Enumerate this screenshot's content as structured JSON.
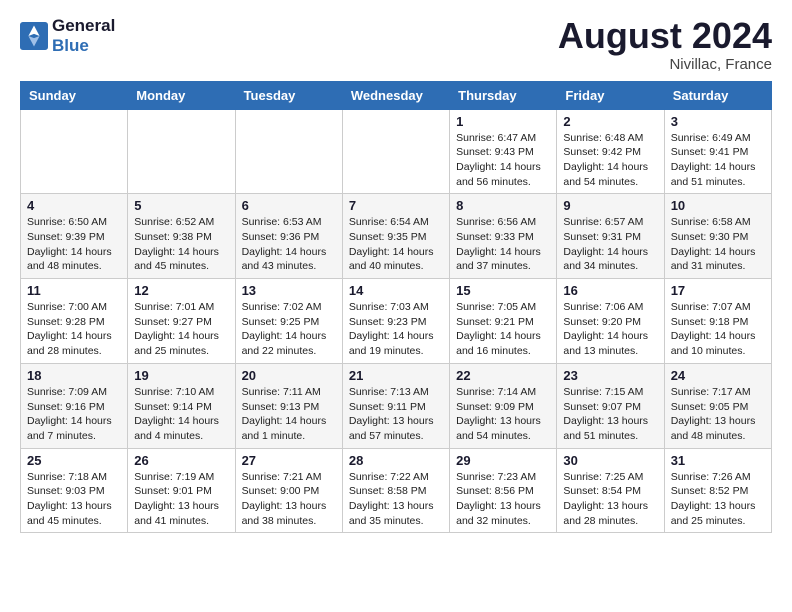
{
  "header": {
    "logo_line1": "General",
    "logo_line2": "Blue",
    "month_year": "August 2024",
    "location": "Nivillac, France"
  },
  "days_of_week": [
    "Sunday",
    "Monday",
    "Tuesday",
    "Wednesday",
    "Thursday",
    "Friday",
    "Saturday"
  ],
  "weeks": [
    [
      {
        "day": "",
        "detail": ""
      },
      {
        "day": "",
        "detail": ""
      },
      {
        "day": "",
        "detail": ""
      },
      {
        "day": "",
        "detail": ""
      },
      {
        "day": "1",
        "detail": "Sunrise: 6:47 AM\nSunset: 9:43 PM\nDaylight: 14 hours\nand 56 minutes."
      },
      {
        "day": "2",
        "detail": "Sunrise: 6:48 AM\nSunset: 9:42 PM\nDaylight: 14 hours\nand 54 minutes."
      },
      {
        "day": "3",
        "detail": "Sunrise: 6:49 AM\nSunset: 9:41 PM\nDaylight: 14 hours\nand 51 minutes."
      }
    ],
    [
      {
        "day": "4",
        "detail": "Sunrise: 6:50 AM\nSunset: 9:39 PM\nDaylight: 14 hours\nand 48 minutes."
      },
      {
        "day": "5",
        "detail": "Sunrise: 6:52 AM\nSunset: 9:38 PM\nDaylight: 14 hours\nand 45 minutes."
      },
      {
        "day": "6",
        "detail": "Sunrise: 6:53 AM\nSunset: 9:36 PM\nDaylight: 14 hours\nand 43 minutes."
      },
      {
        "day": "7",
        "detail": "Sunrise: 6:54 AM\nSunset: 9:35 PM\nDaylight: 14 hours\nand 40 minutes."
      },
      {
        "day": "8",
        "detail": "Sunrise: 6:56 AM\nSunset: 9:33 PM\nDaylight: 14 hours\nand 37 minutes."
      },
      {
        "day": "9",
        "detail": "Sunrise: 6:57 AM\nSunset: 9:31 PM\nDaylight: 14 hours\nand 34 minutes."
      },
      {
        "day": "10",
        "detail": "Sunrise: 6:58 AM\nSunset: 9:30 PM\nDaylight: 14 hours\nand 31 minutes."
      }
    ],
    [
      {
        "day": "11",
        "detail": "Sunrise: 7:00 AM\nSunset: 9:28 PM\nDaylight: 14 hours\nand 28 minutes."
      },
      {
        "day": "12",
        "detail": "Sunrise: 7:01 AM\nSunset: 9:27 PM\nDaylight: 14 hours\nand 25 minutes."
      },
      {
        "day": "13",
        "detail": "Sunrise: 7:02 AM\nSunset: 9:25 PM\nDaylight: 14 hours\nand 22 minutes."
      },
      {
        "day": "14",
        "detail": "Sunrise: 7:03 AM\nSunset: 9:23 PM\nDaylight: 14 hours\nand 19 minutes."
      },
      {
        "day": "15",
        "detail": "Sunrise: 7:05 AM\nSunset: 9:21 PM\nDaylight: 14 hours\nand 16 minutes."
      },
      {
        "day": "16",
        "detail": "Sunrise: 7:06 AM\nSunset: 9:20 PM\nDaylight: 14 hours\nand 13 minutes."
      },
      {
        "day": "17",
        "detail": "Sunrise: 7:07 AM\nSunset: 9:18 PM\nDaylight: 14 hours\nand 10 minutes."
      }
    ],
    [
      {
        "day": "18",
        "detail": "Sunrise: 7:09 AM\nSunset: 9:16 PM\nDaylight: 14 hours\nand 7 minutes."
      },
      {
        "day": "19",
        "detail": "Sunrise: 7:10 AM\nSunset: 9:14 PM\nDaylight: 14 hours\nand 4 minutes."
      },
      {
        "day": "20",
        "detail": "Sunrise: 7:11 AM\nSunset: 9:13 PM\nDaylight: 14 hours\nand 1 minute."
      },
      {
        "day": "21",
        "detail": "Sunrise: 7:13 AM\nSunset: 9:11 PM\nDaylight: 13 hours\nand 57 minutes."
      },
      {
        "day": "22",
        "detail": "Sunrise: 7:14 AM\nSunset: 9:09 PM\nDaylight: 13 hours\nand 54 minutes."
      },
      {
        "day": "23",
        "detail": "Sunrise: 7:15 AM\nSunset: 9:07 PM\nDaylight: 13 hours\nand 51 minutes."
      },
      {
        "day": "24",
        "detail": "Sunrise: 7:17 AM\nSunset: 9:05 PM\nDaylight: 13 hours\nand 48 minutes."
      }
    ],
    [
      {
        "day": "25",
        "detail": "Sunrise: 7:18 AM\nSunset: 9:03 PM\nDaylight: 13 hours\nand 45 minutes."
      },
      {
        "day": "26",
        "detail": "Sunrise: 7:19 AM\nSunset: 9:01 PM\nDaylight: 13 hours\nand 41 minutes."
      },
      {
        "day": "27",
        "detail": "Sunrise: 7:21 AM\nSunset: 9:00 PM\nDaylight: 13 hours\nand 38 minutes."
      },
      {
        "day": "28",
        "detail": "Sunrise: 7:22 AM\nSunset: 8:58 PM\nDaylight: 13 hours\nand 35 minutes."
      },
      {
        "day": "29",
        "detail": "Sunrise: 7:23 AM\nSunset: 8:56 PM\nDaylight: 13 hours\nand 32 minutes."
      },
      {
        "day": "30",
        "detail": "Sunrise: 7:25 AM\nSunset: 8:54 PM\nDaylight: 13 hours\nand 28 minutes."
      },
      {
        "day": "31",
        "detail": "Sunrise: 7:26 AM\nSunset: 8:52 PM\nDaylight: 13 hours\nand 25 minutes."
      }
    ]
  ]
}
